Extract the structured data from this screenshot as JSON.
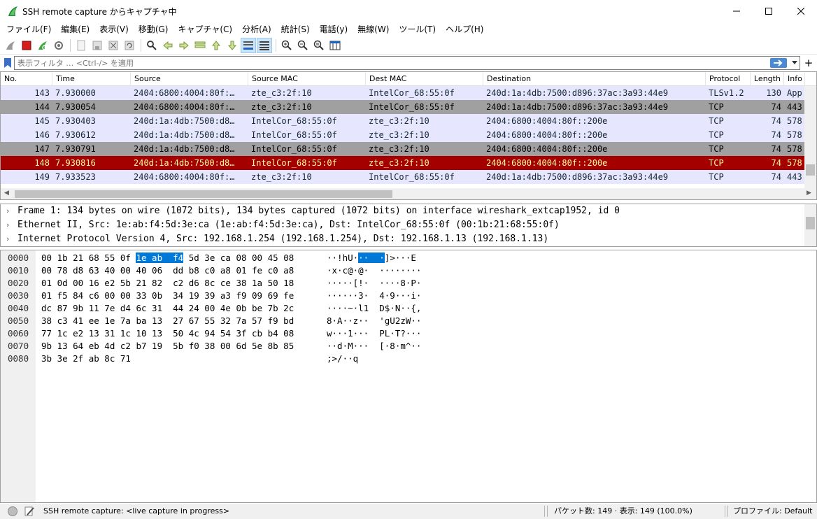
{
  "window": {
    "title": "SSH remote capture からキャプチャ中"
  },
  "menu": [
    "ファイル(F)",
    "編集(E)",
    "表示(V)",
    "移動(G)",
    "キャプチャ(C)",
    "分析(A)",
    "統計(S)",
    "電話(y)",
    "無線(W)",
    "ツール(T)",
    "ヘルプ(H)"
  ],
  "filter": {
    "placeholder": "表示フィルタ … <Ctrl-/> を適用"
  },
  "packet_list": {
    "columns": [
      "No.",
      "Time",
      "Source",
      "Source MAC",
      "Dest MAC",
      "Destination",
      "Protocol",
      "Length",
      "Info"
    ],
    "rows": [
      {
        "no": "143",
        "time": "7.930000",
        "source": "2404:6800:4004:80f:…",
        "src_mac": "zte_c3:2f:10",
        "dst_mac": "IntelCor_68:55:0f",
        "destination": "240d:1a:4db:7500:d896:37ac:3a93:44e9",
        "protocol": "TLSv1.2",
        "length": "130",
        "info": "App",
        "style": "tcp"
      },
      {
        "no": "144",
        "time": "7.930054",
        "source": "2404:6800:4004:80f:…",
        "src_mac": "zte_c3:2f:10",
        "dst_mac": "IntelCor_68:55:0f",
        "destination": "240d:1a:4db:7500:d896:37ac:3a93:44e9",
        "protocol": "TCP",
        "length": "74",
        "info": "443",
        "style": "gray"
      },
      {
        "no": "145",
        "time": "7.930403",
        "source": "240d:1a:4db:7500:d8…",
        "src_mac": "IntelCor_68:55:0f",
        "dst_mac": "zte_c3:2f:10",
        "destination": "2404:6800:4004:80f::200e",
        "protocol": "TCP",
        "length": "74",
        "info": "578",
        "style": "tcp"
      },
      {
        "no": "146",
        "time": "7.930612",
        "source": "240d:1a:4db:7500:d8…",
        "src_mac": "IntelCor_68:55:0f",
        "dst_mac": "zte_c3:2f:10",
        "destination": "2404:6800:4004:80f::200e",
        "protocol": "TCP",
        "length": "74",
        "info": "578",
        "style": "tcp"
      },
      {
        "no": "147",
        "time": "7.930791",
        "source": "240d:1a:4db:7500:d8…",
        "src_mac": "IntelCor_68:55:0f",
        "dst_mac": "zte_c3:2f:10",
        "destination": "2404:6800:4004:80f::200e",
        "protocol": "TCP",
        "length": "74",
        "info": "578",
        "style": "gray"
      },
      {
        "no": "148",
        "time": "7.930816",
        "source": "240d:1a:4db:7500:d8…",
        "src_mac": "IntelCor_68:55:0f",
        "dst_mac": "zte_c3:2f:10",
        "destination": "2404:6800:4004:80f::200e",
        "protocol": "TCP",
        "length": "74",
        "info": "578",
        "style": "bad"
      },
      {
        "no": "149",
        "time": "7.933523",
        "source": "2404:6800:4004:80f:…",
        "src_mac": "zte_c3:2f:10",
        "dst_mac": "IntelCor_68:55:0f",
        "destination": "240d:1a:4db:7500:d896:37ac:3a93:44e9",
        "protocol": "TCP",
        "length": "74",
        "info": "443",
        "style": "tcp"
      }
    ]
  },
  "details": [
    "Frame 1: 134 bytes on wire (1072 bits), 134 bytes captured (1072 bits) on interface wireshark_extcap1952, id 0",
    "Ethernet II, Src: 1e:ab:f4:5d:3e:ca (1e:ab:f4:5d:3e:ca), Dst: IntelCor_68:55:0f (00:1b:21:68:55:0f)",
    "Internet Protocol Version 4, Src: 192.168.1.254 (192.168.1.254), Dst: 192.168.1.13 (192.168.1.13)"
  ],
  "bytes": [
    {
      "offset": "0000",
      "hex_pre": "00 1b 21 68 55 0f ",
      "hex_hl": "1e ab  f4",
      "hex_post": " 5d 3e ca 08 00 45 08",
      "ascii_pre": "··!hU·",
      "ascii_hl": "··  ·",
      "ascii_post": "]>···E"
    },
    {
      "offset": "0010",
      "hex": "00 78 d8 63 40 00 40 06  dd b8 c0 a8 01 fe c0 a8",
      "ascii": "·x·c@·@·  ········"
    },
    {
      "offset": "0020",
      "hex": "01 0d 00 16 e2 5b 21 82  c2 d6 8c ce 38 1a 50 18",
      "ascii": "·····[!·  ····8·P·"
    },
    {
      "offset": "0030",
      "hex": "01 f5 84 c6 00 00 33 0b  34 19 39 a3 f9 09 69 fe",
      "ascii": "······3·  4·9···i·"
    },
    {
      "offset": "0040",
      "hex": "dc 87 9b 11 7e d4 6c 31  44 24 00 4e 0b be 7b 2c",
      "ascii": "····~·l1  D$·N··{,"
    },
    {
      "offset": "0050",
      "hex": "38 c3 41 ee 1e 7a ba 13  27 67 55 32 7a 57 f9 bd",
      "ascii": "8·A··z··  'gU2zW··"
    },
    {
      "offset": "0060",
      "hex": "77 1c e2 13 31 1c 10 13  50 4c 94 54 3f cb b4 08",
      "ascii": "w···1···  PL·T?···"
    },
    {
      "offset": "0070",
      "hex": "9b 13 64 eb 4d c2 b7 19  5b f0 38 00 6d 5e 8b 85",
      "ascii": "··d·M···  [·8·m^··"
    },
    {
      "offset": "0080",
      "hex": "3b 3e 2f ab 8c 71",
      "ascii": ";>/··q"
    }
  ],
  "status": {
    "capture_text": "SSH remote capture: <live capture in progress>",
    "packets_text": "パケット数: 149 · 表示: 149 (100.0%)",
    "profile_text": "プロファイル: Default"
  },
  "colors": {
    "tcp_row": "#e7e6ff",
    "gray_row": "#a0a0a0",
    "bad_row": "#a40000",
    "bad_text": "#fffc9c",
    "selection": "#0078d7"
  }
}
